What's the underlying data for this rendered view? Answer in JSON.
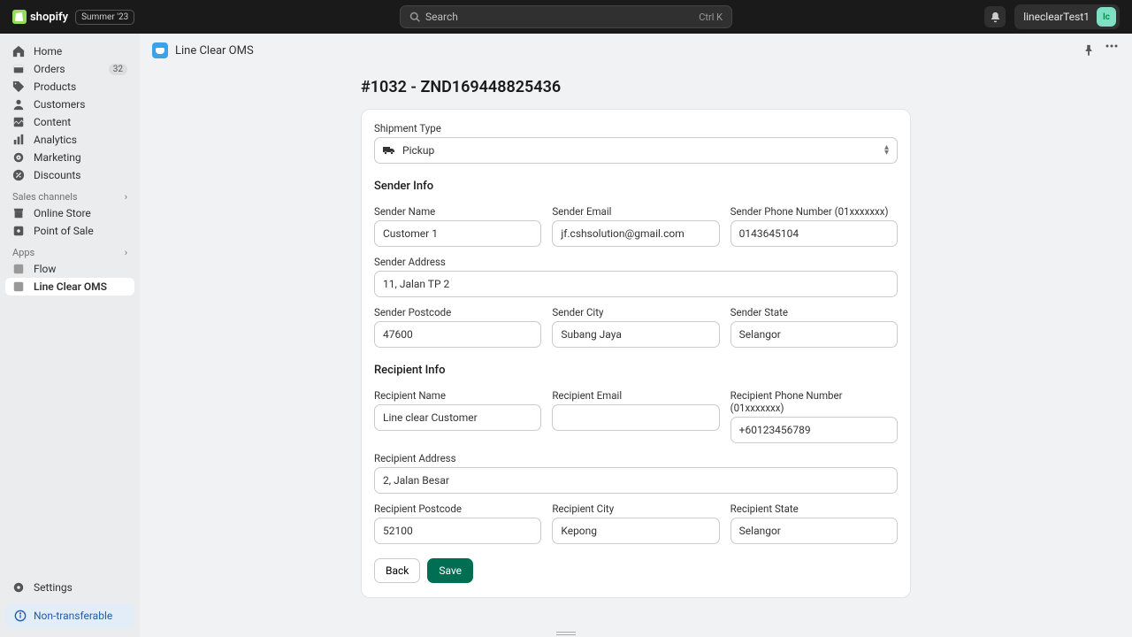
{
  "topbar": {
    "brand": "shopify",
    "edition": "Summer '23",
    "search_placeholder": "Search",
    "search_shortcut": "Ctrl K",
    "account_name": "lineclearTest1",
    "avatar_initials": "lc"
  },
  "sidebar": {
    "items": [
      {
        "label": "Home"
      },
      {
        "label": "Orders",
        "badge": "32"
      },
      {
        "label": "Products"
      },
      {
        "label": "Customers"
      },
      {
        "label": "Content"
      },
      {
        "label": "Analytics"
      },
      {
        "label": "Marketing"
      },
      {
        "label": "Discounts"
      }
    ],
    "channels_header": "Sales channels",
    "channels": [
      {
        "label": "Online Store"
      },
      {
        "label": "Point of Sale"
      }
    ],
    "apps_header": "Apps",
    "apps": [
      {
        "label": "Flow"
      },
      {
        "label": "Line Clear OMS",
        "active": true
      }
    ],
    "settings_label": "Settings",
    "nontransferable_label": "Non-transferable"
  },
  "page": {
    "app_name": "Line Clear OMS",
    "title": "#1032 - ZND169448825436"
  },
  "form": {
    "shipment_type_label": "Shipment Type",
    "shipment_type_value": "Pickup",
    "sender_info_title": "Sender Info",
    "sender_name_label": "Sender Name",
    "sender_name": "Customer 1",
    "sender_email_label": "Sender Email",
    "sender_email": "jf.cshsolution@gmail.com",
    "sender_phone_label": "Sender Phone Number (01xxxxxxx)",
    "sender_phone": "0143645104",
    "sender_address_label": "Sender Address",
    "sender_address": "11, Jalan TP 2",
    "sender_postcode_label": "Sender Postcode",
    "sender_postcode": "47600",
    "sender_city_label": "Sender City",
    "sender_city": "Subang Jaya",
    "sender_state_label": "Sender State",
    "sender_state": "Selangor",
    "recipient_info_title": "Recipient Info",
    "recipient_name_label": "Recipient Name",
    "recipient_name": "Line clear Customer",
    "recipient_email_label": "Recipient Email",
    "recipient_email": "",
    "recipient_phone_label": "Recipient Phone Number (01xxxxxxx)",
    "recipient_phone": "+60123456789",
    "recipient_address_label": "Recipient Address",
    "recipient_address": "2, Jalan Besar",
    "recipient_postcode_label": "Recipient Postcode",
    "recipient_postcode": "52100",
    "recipient_city_label": "Recipient City",
    "recipient_city": "Kepong",
    "recipient_state_label": "Recipient State",
    "recipient_state": "Selangor",
    "back_label": "Back",
    "save_label": "Save"
  }
}
